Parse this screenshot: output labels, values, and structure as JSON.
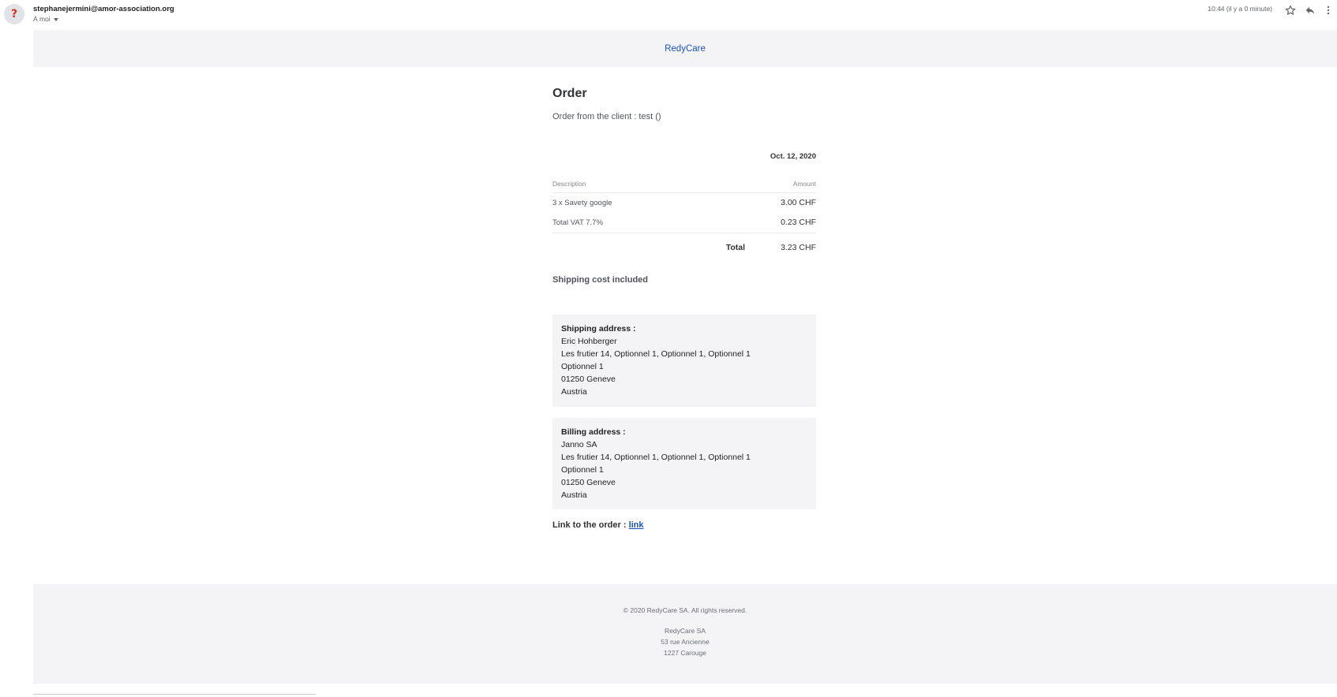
{
  "mail": {
    "avatar_glyph": "?",
    "sender": "stephanejermini@amor-association.org",
    "recipient": "À moi",
    "timestamp": "10:44 (il y a 0 minute)"
  },
  "brand": {
    "name": "RedyCare",
    "link_color": "#1a55b5"
  },
  "order": {
    "title": "Order",
    "subtitle": "Order from the client : test ()",
    "date": "Oct. 12, 2020",
    "table": {
      "headers": {
        "description": "Description",
        "amount": "Amount"
      },
      "rows": [
        {
          "description": "3 x Savety google",
          "amount": "3.00 CHF"
        },
        {
          "description": "Total VAT 7.7%",
          "amount": "0.23 CHF"
        }
      ],
      "total_label": "Total",
      "total_amount": "3.23 CHF"
    },
    "shipping_note": "Shipping cost included"
  },
  "shipping_address": {
    "title": "Shipping address :",
    "name": "Eric Hohberger",
    "line1": "Les frutier 14, Optionnel 1, Optionnel 1, Optionnel 1",
    "line2": "Optionnel 1",
    "city": "01250 Geneve",
    "country": "Austria"
  },
  "billing_address": {
    "title": "Billing address :",
    "name": "Janno SA",
    "line1": "Les frutier 14, Optionnel 1, Optionnel 1, Optionnel 1",
    "line2": "Optionnel 1",
    "city": "01250 Geneve",
    "country": "Austria"
  },
  "order_link": {
    "label": "Link to the order : ",
    "link_text": "link"
  },
  "footer": {
    "copyright": "© 2020 RedyCare SA. All rights reserved.",
    "company": "RedyCare SA",
    "street": "53 rue Ancienne",
    "city": "1227 Carouge"
  },
  "icons": {
    "avatar": "unknown-sender-icon",
    "star": "star-icon",
    "reply": "reply-icon",
    "more": "more-vert-icon"
  }
}
